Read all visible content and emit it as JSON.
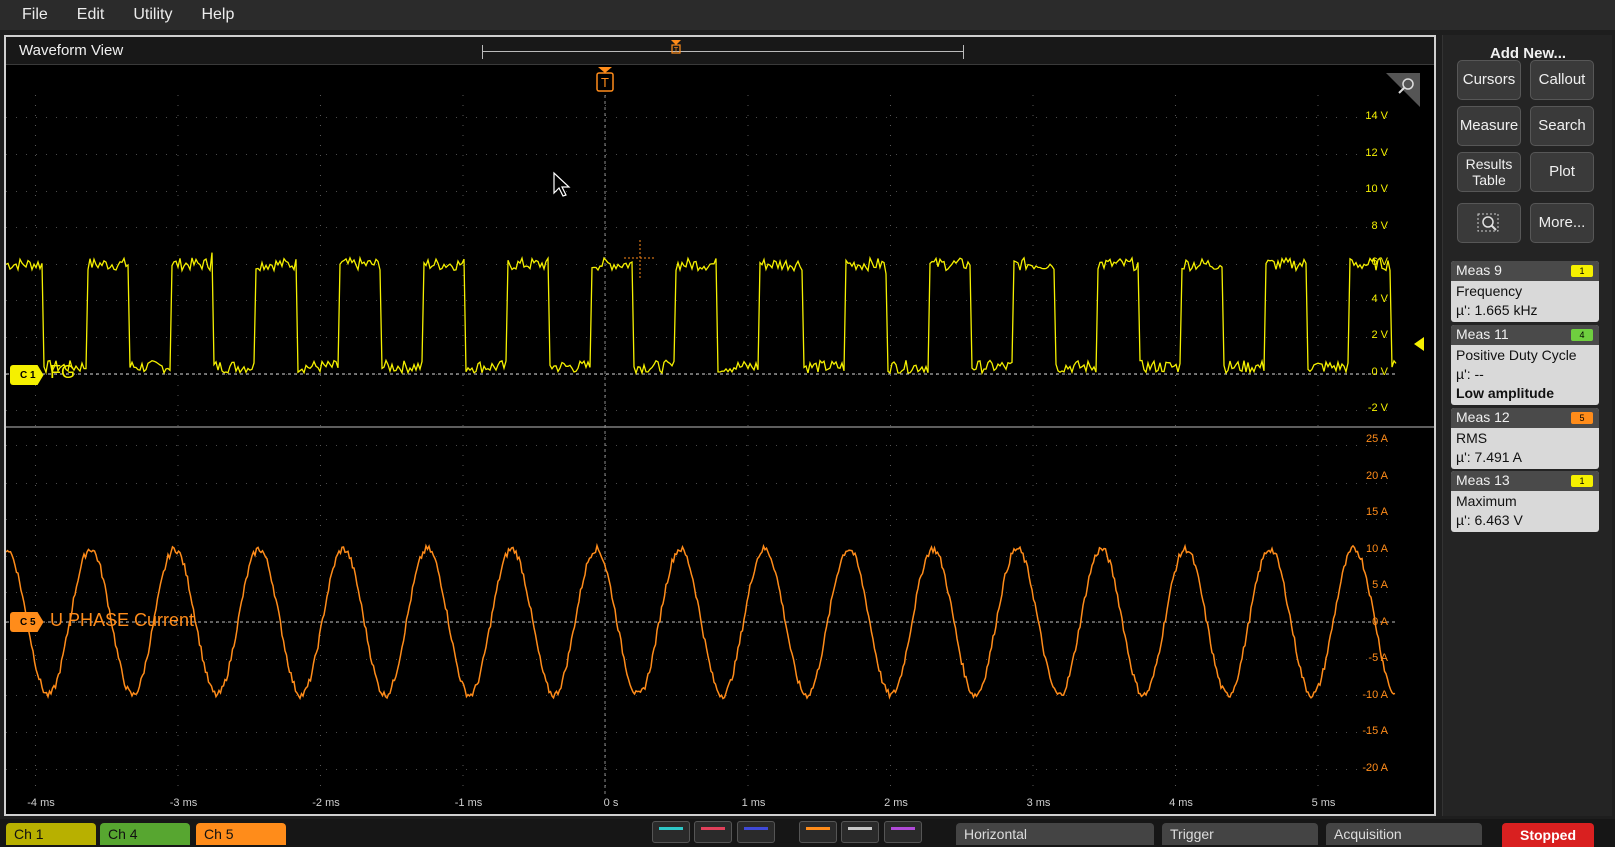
{
  "menu": [
    "File",
    "Edit",
    "Utility",
    "Help"
  ],
  "waveform_view": {
    "title": "Waveform View",
    "record_marker_label": "T",
    "trigger_marker_label": "T"
  },
  "channels": {
    "c1": {
      "badge": "C 1",
      "label": "FG",
      "color": "#f5f000"
    },
    "c5": {
      "badge": "C 5",
      "label": "U PHASE Current",
      "color": "#ff8c1a"
    }
  },
  "c1_y_ticks": [
    "14 V",
    "12 V",
    "10 V",
    "8 V",
    "6 V",
    "4 V",
    "2 V",
    "0 V",
    "-2 V"
  ],
  "c5_y_ticks": [
    "25 A",
    "20 A",
    "15 A",
    "10 A",
    "5 A",
    "0 A",
    "-5 A",
    "-10 A",
    "-15 A",
    "-20 A"
  ],
  "x_ticks": [
    "-4 ms",
    "-3 ms",
    "-2 ms",
    "-1 ms",
    "0 s",
    "1 ms",
    "2 ms",
    "3 ms",
    "4 ms",
    "5 ms"
  ],
  "signals": {
    "c1_square": {
      "frequency_khz": 1.665,
      "high_v": 6,
      "low_v": 0.4,
      "duty": 0.5,
      "cycles_visible": 16.5
    },
    "c5_sine": {
      "amplitude_a": 10,
      "offset_a": 0,
      "cycles_visible": 16.5
    }
  },
  "right_panel": {
    "title": "Add New...",
    "buttons": {
      "cursors": "Cursors",
      "callout": "Callout",
      "measure": "Measure",
      "search": "Search",
      "results_table": "Results Table",
      "plot": "Plot",
      "more": "More..."
    },
    "measurements": [
      {
        "name": "Meas 9",
        "channel": "1",
        "channel_color": "#f5f000",
        "type": "Frequency",
        "value": "µ': 1.665 kHz",
        "warning": ""
      },
      {
        "name": "Meas 11",
        "channel": "4",
        "channel_color": "#6fcf3f",
        "type": "Positive Duty Cycle",
        "value": "µ': --",
        "warning": "Low amplitude"
      },
      {
        "name": "Meas 12",
        "channel": "5",
        "channel_color": "#ff8c1a",
        "type": "RMS",
        "value": "µ': 7.491 A",
        "warning": ""
      },
      {
        "name": "Meas 13",
        "channel": "1",
        "channel_color": "#f5f000",
        "type": "Maximum",
        "value": "µ': 6.463 V",
        "warning": ""
      }
    ]
  },
  "bottom_bar": {
    "ch_tabs": [
      {
        "label": "Ch 1",
        "color": "#b8b000"
      },
      {
        "label": "Ch 4",
        "color": "#57a630"
      },
      {
        "label": "Ch 5",
        "color": "#ff8c1a"
      }
    ],
    "swatch_colors": [
      "#2ec8c8",
      "#e0405a",
      "#3f49d8",
      "#ff8c1a",
      "#c8c8c8",
      "#b04ad8"
    ],
    "horizontal": "Horizontal",
    "trigger": "Trigger",
    "acquisition": "Acquisition",
    "stopped": "Stopped"
  }
}
